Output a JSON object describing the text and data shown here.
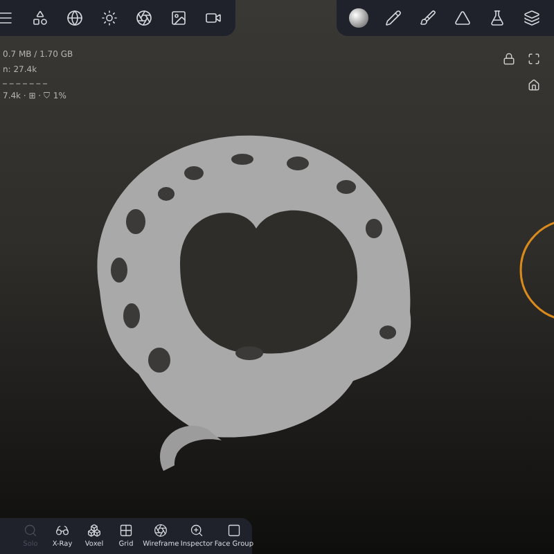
{
  "stats": [
    "0.7 MB / 1.70 GB",
    "n: 27.4k",
    "7.4k · ⊞ · ⛉ 1%"
  ],
  "bottom_tools": [
    {
      "label": "Solo",
      "disabled": true
    },
    {
      "label": "X-Ray",
      "disabled": false
    },
    {
      "label": "Voxel",
      "disabled": false
    },
    {
      "label": "Grid",
      "disabled": false
    },
    {
      "label": "Wireframe",
      "disabled": false
    },
    {
      "label": "Inspector",
      "disabled": false
    },
    {
      "label": "Face Group",
      "disabled": false
    }
  ]
}
